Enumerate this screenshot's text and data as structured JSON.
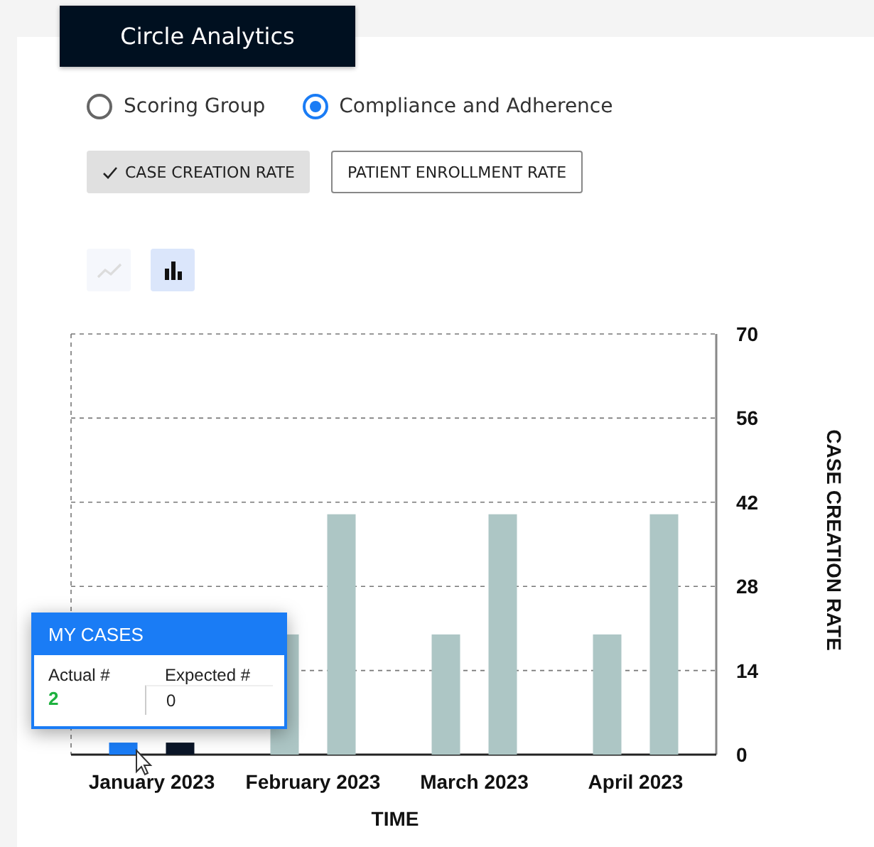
{
  "title": "Circle Analytics",
  "radios": [
    {
      "label": "Scoring Group",
      "selected": false
    },
    {
      "label": "Compliance and Adherence",
      "selected": true
    }
  ],
  "metrics": [
    {
      "label": "CASE CREATION RATE",
      "selected": true
    },
    {
      "label": "PATIENT ENROLLMENT RATE",
      "selected": false
    }
  ],
  "chart_types": [
    {
      "kind": "line",
      "selected": false
    },
    {
      "kind": "bar",
      "selected": true
    }
  ],
  "chart_data": {
    "type": "bar",
    "xlabel": "TIME",
    "ylabel": "CASE CREATION RATE",
    "categories": [
      "January 2023",
      "February 2023",
      "March 2023",
      "April 2023"
    ],
    "series": [
      {
        "color": "#1a7cf5",
        "values": [
          2,
          null,
          null,
          null
        ]
      },
      {
        "color": "#0b1628",
        "values": [
          2,
          null,
          null,
          null
        ]
      },
      {
        "color": "#adc6c5",
        "values": [
          null,
          20,
          20,
          20
        ]
      },
      {
        "color": "#adc6c5",
        "values": [
          null,
          40,
          40,
          40
        ]
      }
    ],
    "grid": true,
    "ylim": [
      0,
      70
    ],
    "yticks": [
      0,
      14,
      28,
      42,
      56,
      70
    ]
  },
  "tooltip": {
    "title": "MY CASES",
    "columns": [
      {
        "label": "Actual #",
        "value": "2",
        "kind": "plain"
      },
      {
        "label": "Expected #",
        "value": "0",
        "kind": "boxed"
      }
    ]
  }
}
